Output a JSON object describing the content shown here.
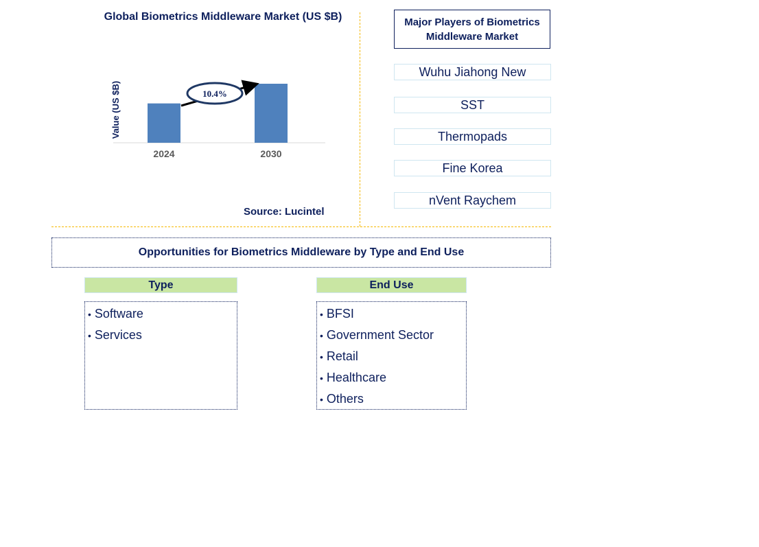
{
  "chart_data": {
    "type": "bar",
    "title": "Global Biometrics Middleware Market (US $B)",
    "xlabel": "",
    "ylabel": "Value (US $B)",
    "categories": [
      "2024",
      "2030"
    ],
    "values": [
      1.0,
      1.5
    ],
    "annotation": {
      "label": "10.4%",
      "meaning": "CAGR 2024-2030"
    },
    "grid": false,
    "colors": {
      "bar": "#4f81bd",
      "text": "#0d1f5c",
      "tick": "#595959"
    }
  },
  "source": "Source: Lucintel",
  "players": {
    "title": "Major Players of Biometrics Middleware Market",
    "items": [
      "Wuhu Jiahong New",
      "SST",
      "Thermopads",
      "Fine Korea",
      "nVent Raychem"
    ]
  },
  "opportunities": {
    "title": "Opportunities for Biometrics Middleware by Type and End Use",
    "type": {
      "header": "Type",
      "items": [
        "Software",
        "Services"
      ]
    },
    "end_use": {
      "header": "End Use",
      "items": [
        "BFSI",
        "Government Sector",
        "Retail",
        "Healthcare",
        "Others"
      ]
    }
  },
  "colors": {
    "accent_divider": "#f5b800",
    "header_fill": "#c9e6a3",
    "navy": "#0d1f5c"
  }
}
